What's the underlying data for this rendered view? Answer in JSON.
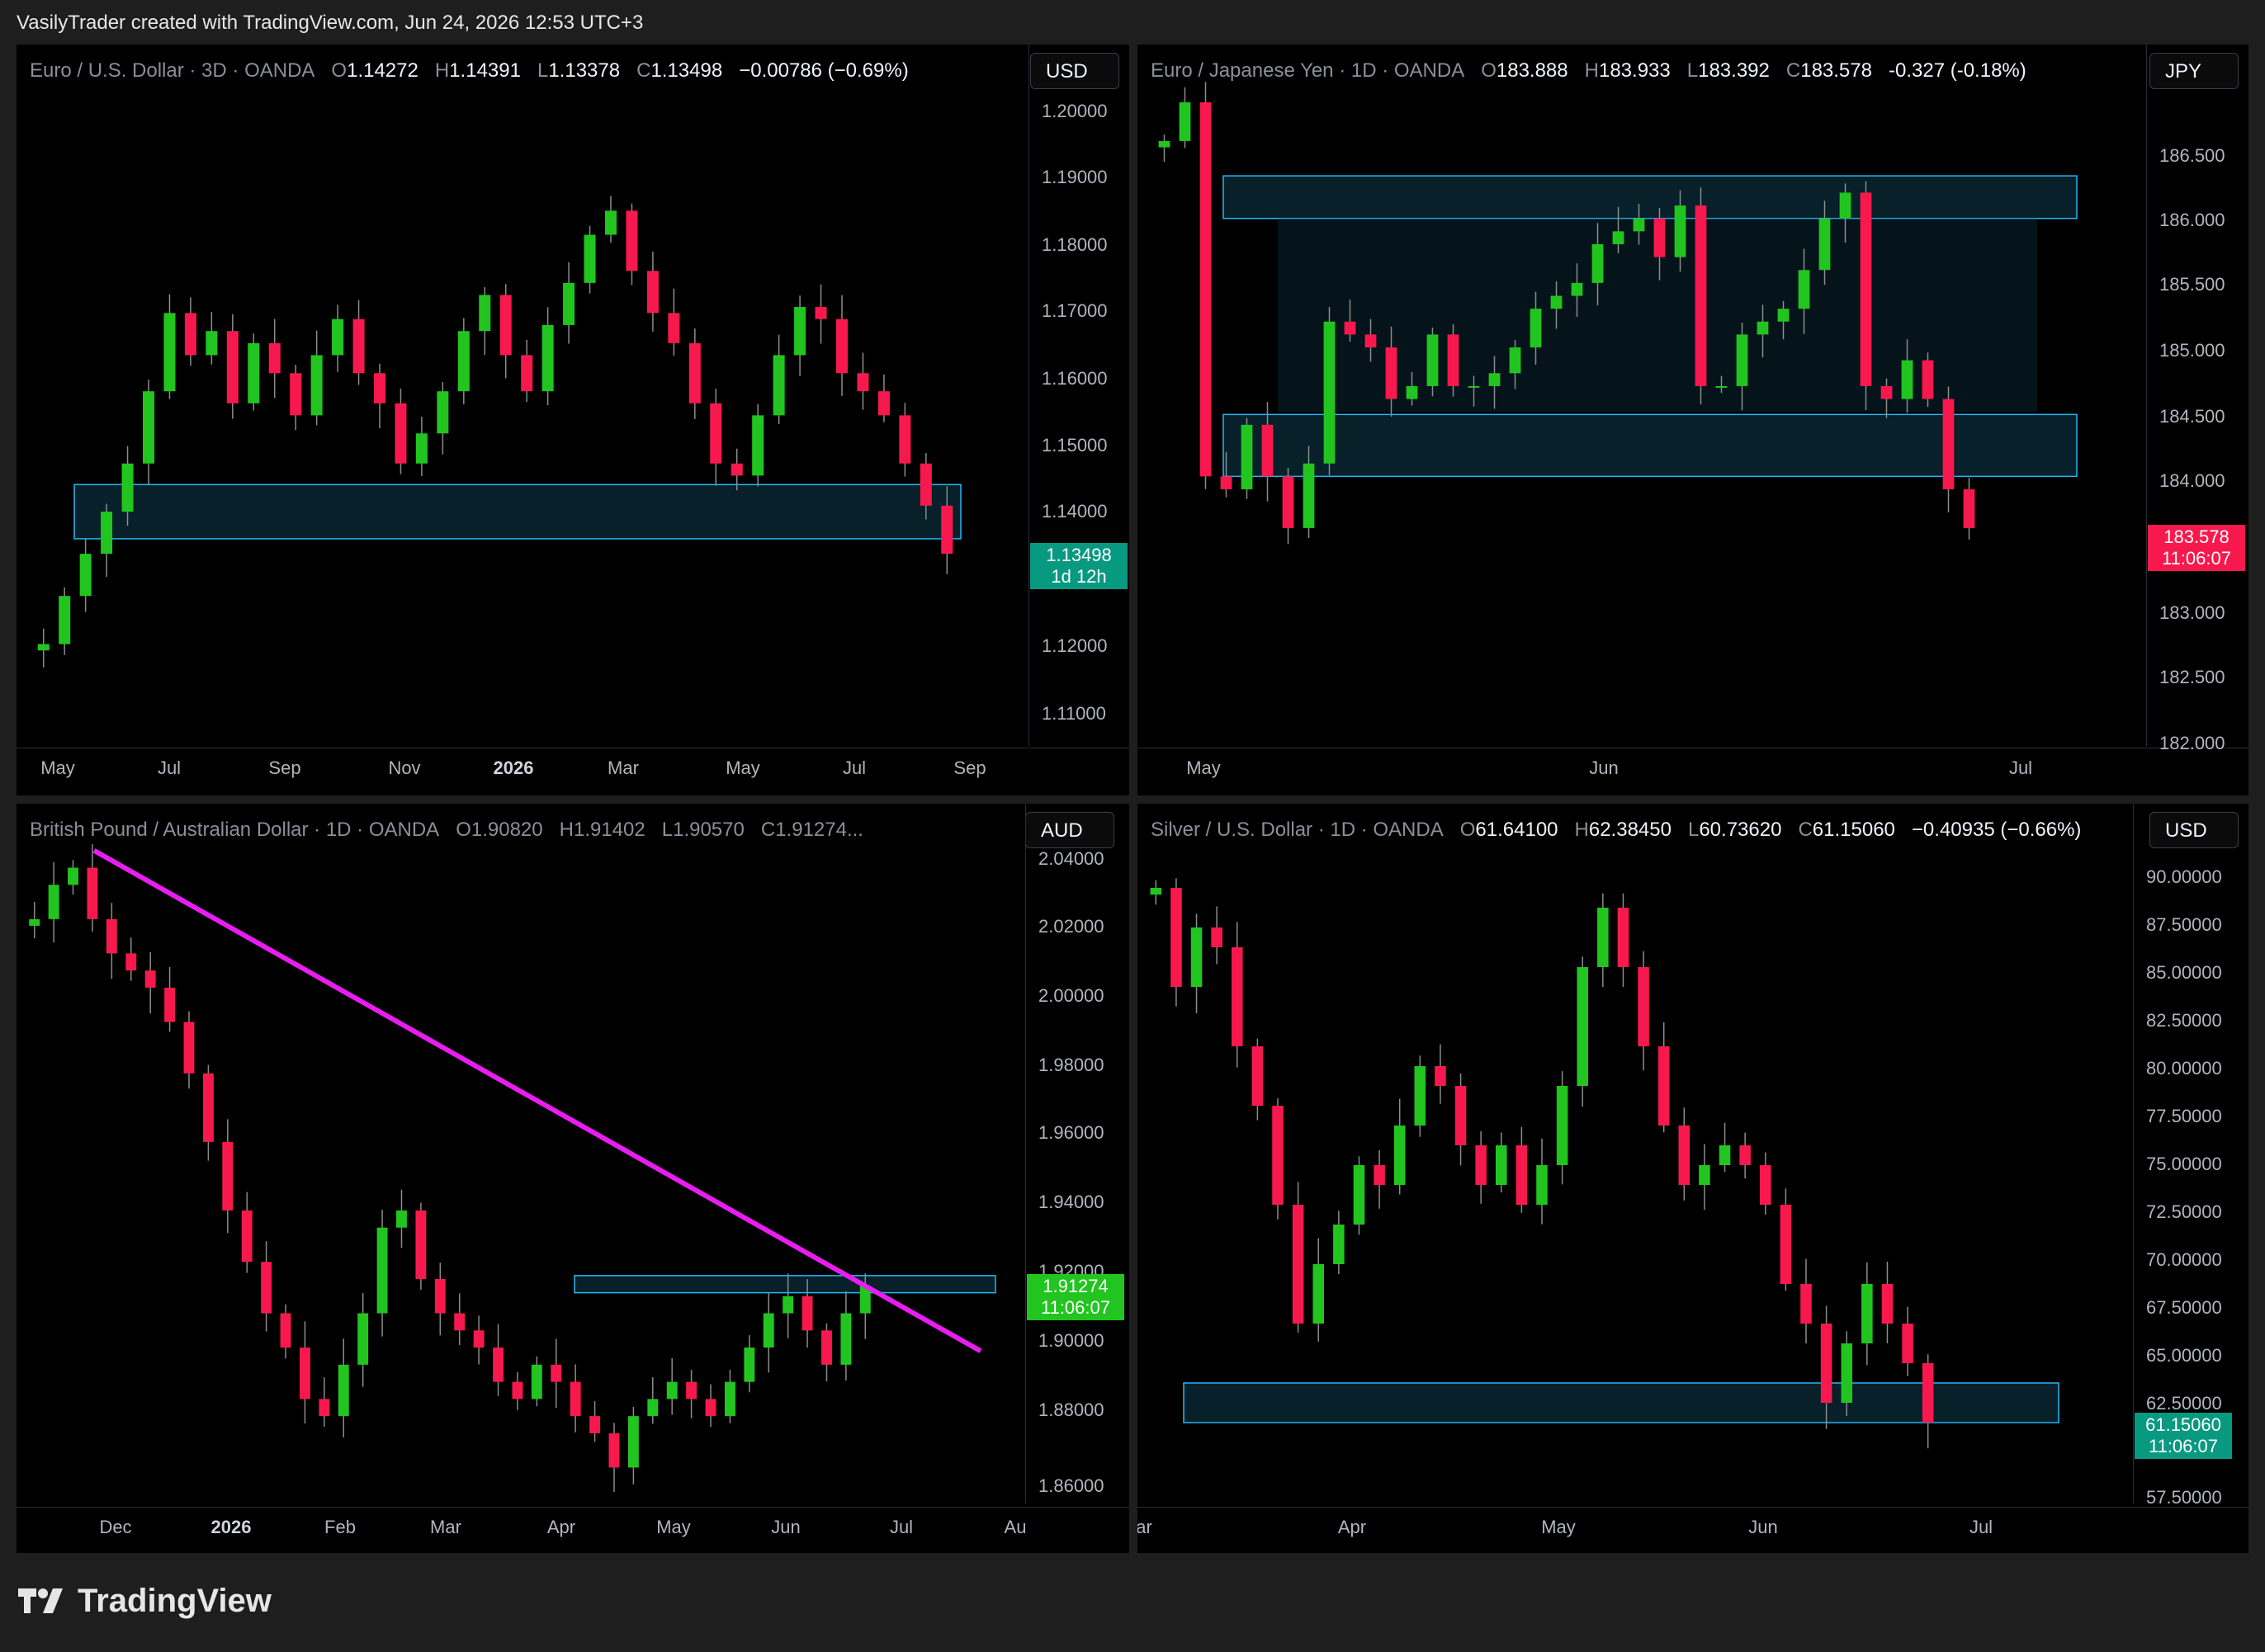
{
  "header": {
    "attribution": "VasilyTrader created with TradingView.com, Jun 24, 2026 12:53 UTC+3"
  },
  "footer": {
    "brand": "TradingView"
  },
  "colors": {
    "up": "#22c51f",
    "down": "#f7194d",
    "zone_border": "#29b6f6",
    "zone_fill": "#0d3a4a",
    "trendline": "#e81df0"
  },
  "panels": [
    {
      "id": "eurusd",
      "title": "Euro / U.S. Dollar · 3D · OANDA",
      "ohlc": {
        "O": "1.14272",
        "H": "1.14391",
        "L": "1.13378",
        "C": "1.13498",
        "chg": "−0.00786 (−0.69%)"
      },
      "currency": "USD",
      "price_tag": {
        "value": "1.13498",
        "sub": "1d 12h",
        "color": "#089981"
      },
      "y_ticks": [
        "1.20000",
        "1.19000",
        "1.18000",
        "1.17000",
        "1.16000",
        "1.15000",
        "1.14000",
        "1.13000",
        "1.12000",
        "1.11000"
      ],
      "x_ticks": [
        "May",
        "Jul",
        "Sep",
        "Nov",
        "2026",
        "Mar",
        "May",
        "Jul",
        "Sep"
      ]
    },
    {
      "id": "eurjpy",
      "title": "Euro / Japanese Yen · 1D · OANDA",
      "ohlc": {
        "O": "183.888",
        "H": "183.933",
        "L": "183.392",
        "C": "183.578",
        "chg": "-0.327 (-0.18%)"
      },
      "currency": "JPY",
      "price_tag": {
        "value": "183.578",
        "sub": "11:06:07",
        "color": "#f7194d"
      },
      "y_ticks": [
        "186.500",
        "186.000",
        "185.500",
        "185.000",
        "184.500",
        "184.000",
        "183.500",
        "183.000",
        "182.500",
        "182.000"
      ],
      "x_ticks": [
        "May",
        "Jun",
        "Jul"
      ]
    },
    {
      "id": "gbpaud",
      "title": "British Pound / Australian Dollar · 1D · OANDA",
      "ohlc": {
        "O": "1.90820",
        "H": "1.91402",
        "L": "1.90570",
        "C": "1.91274..."
      },
      "currency": "AUD",
      "price_tag": {
        "value": "1.91274",
        "sub": "11:06:07",
        "color": "#22c51f"
      },
      "y_ticks": [
        "2.04000",
        "2.02000",
        "2.00000",
        "1.98000",
        "1.96000",
        "1.94000",
        "1.92000",
        "1.90000",
        "1.88000",
        "1.86000"
      ],
      "x_ticks": [
        "Dec",
        "2026",
        "Feb",
        "Mar",
        "Apr",
        "May",
        "Jun",
        "Jul",
        "Au"
      ]
    },
    {
      "id": "xagusd",
      "title": "Silver / U.S. Dollar · 1D · OANDA",
      "ohlc": {
        "O": "61.64100",
        "H": "62.38450",
        "L": "60.73620",
        "C": "61.15060",
        "chg": "−0.40935 (−0.66%)"
      },
      "currency": "USD",
      "price_tag": {
        "value": "61.15060",
        "sub": "11:06:07",
        "color": "#089981"
      },
      "y_ticks": [
        "90.00000",
        "87.50000",
        "85.00000",
        "82.50000",
        "80.00000",
        "77.50000",
        "75.00000",
        "72.50000",
        "70.00000",
        "67.50000",
        "65.00000",
        "62.50000",
        "60.00000",
        "57.50000"
      ],
      "x_ticks": [
        "ar",
        "Apr",
        "May",
        "Jun",
        "Jul"
      ]
    }
  ],
  "chart_data": [
    {
      "type": "candlestick",
      "title": "Euro / U.S. Dollar · 3D · OANDA",
      "ylim": [
        1.105,
        1.21
      ],
      "zones": [
        {
          "from": 1.1375,
          "to": 1.1465
        }
      ],
      "close_series": [
        1.12,
        1.128,
        1.135,
        1.142,
        1.15,
        1.162,
        1.175,
        1.168,
        1.172,
        1.16,
        1.17,
        1.165,
        1.158,
        1.168,
        1.174,
        1.165,
        1.16,
        1.15,
        1.155,
        1.162,
        1.172,
        1.178,
        1.168,
        1.162,
        1.173,
        1.18,
        1.188,
        1.192,
        1.182,
        1.175,
        1.17,
        1.16,
        1.15,
        1.148,
        1.158,
        1.168,
        1.176,
        1.174,
        1.165,
        1.162,
        1.158,
        1.15,
        1.143,
        1.135
      ]
    },
    {
      "type": "candlestick",
      "title": "Euro / Japanese Yen · 1D · OANDA",
      "ylim": [
        182.0,
        186.9
      ],
      "zones": [
        {
          "from": 186.0,
          "to": 186.33
        },
        {
          "from": 184.0,
          "to": 184.48
        },
        {
          "from": 184.5,
          "to": 186.0
        }
      ],
      "close_series": [
        186.6,
        186.9,
        184.0,
        183.9,
        184.4,
        184.0,
        183.6,
        184.1,
        185.2,
        185.1,
        185.0,
        184.6,
        184.7,
        185.1,
        184.7,
        184.7,
        184.8,
        185.0,
        185.3,
        185.4,
        185.5,
        185.8,
        185.9,
        186.0,
        185.7,
        186.1,
        184.7,
        184.7,
        185.1,
        185.2,
        185.3,
        185.6,
        186.0,
        186.2,
        184.7,
        184.6,
        184.9,
        184.6,
        183.9,
        183.6
      ]
    },
    {
      "type": "candlestick",
      "title": "British Pound / Australian Dollar · 1D · OANDA",
      "ylim": [
        1.85,
        2.045
      ],
      "zones": [
        {
          "from": 1.911,
          "to": 1.916
        }
      ],
      "trendline": [
        {
          "date": "Nov",
          "price": 2.04
        },
        {
          "date": "Jul",
          "price": 1.894
        }
      ],
      "close_series": [
        2.02,
        2.03,
        2.035,
        2.02,
        2.01,
        2.005,
        2.0,
        1.99,
        1.975,
        1.955,
        1.935,
        1.92,
        1.905,
        1.895,
        1.88,
        1.875,
        1.89,
        1.905,
        1.93,
        1.935,
        1.915,
        1.905,
        1.9,
        1.895,
        1.885,
        1.88,
        1.89,
        1.885,
        1.875,
        1.87,
        1.86,
        1.875,
        1.88,
        1.885,
        1.88,
        1.875,
        1.885,
        1.895,
        1.905,
        1.91,
        1.9,
        1.89,
        1.905,
        1.913
      ]
    },
    {
      "type": "candlestick",
      "title": "Silver / U.S. Dollar · 1D · OANDA",
      "ylim": [
        57.0,
        91.0
      ],
      "zones": [
        {
          "from": 61.0,
          "to": 63.0
        }
      ],
      "close_series": [
        88.0,
        83.0,
        86.0,
        85.0,
        80.0,
        77.0,
        72.0,
        66.0,
        69.0,
        71.0,
        74.0,
        73.0,
        76.0,
        79.0,
        78.0,
        75.0,
        73.0,
        75.0,
        72.0,
        74.0,
        78.0,
        84.0,
        87.0,
        84.0,
        80.0,
        76.0,
        73.0,
        74.0,
        75.0,
        74.0,
        72.0,
        68.0,
        66.0,
        62.0,
        65.0,
        68.0,
        66.0,
        64.0,
        61.0
      ]
    }
  ]
}
